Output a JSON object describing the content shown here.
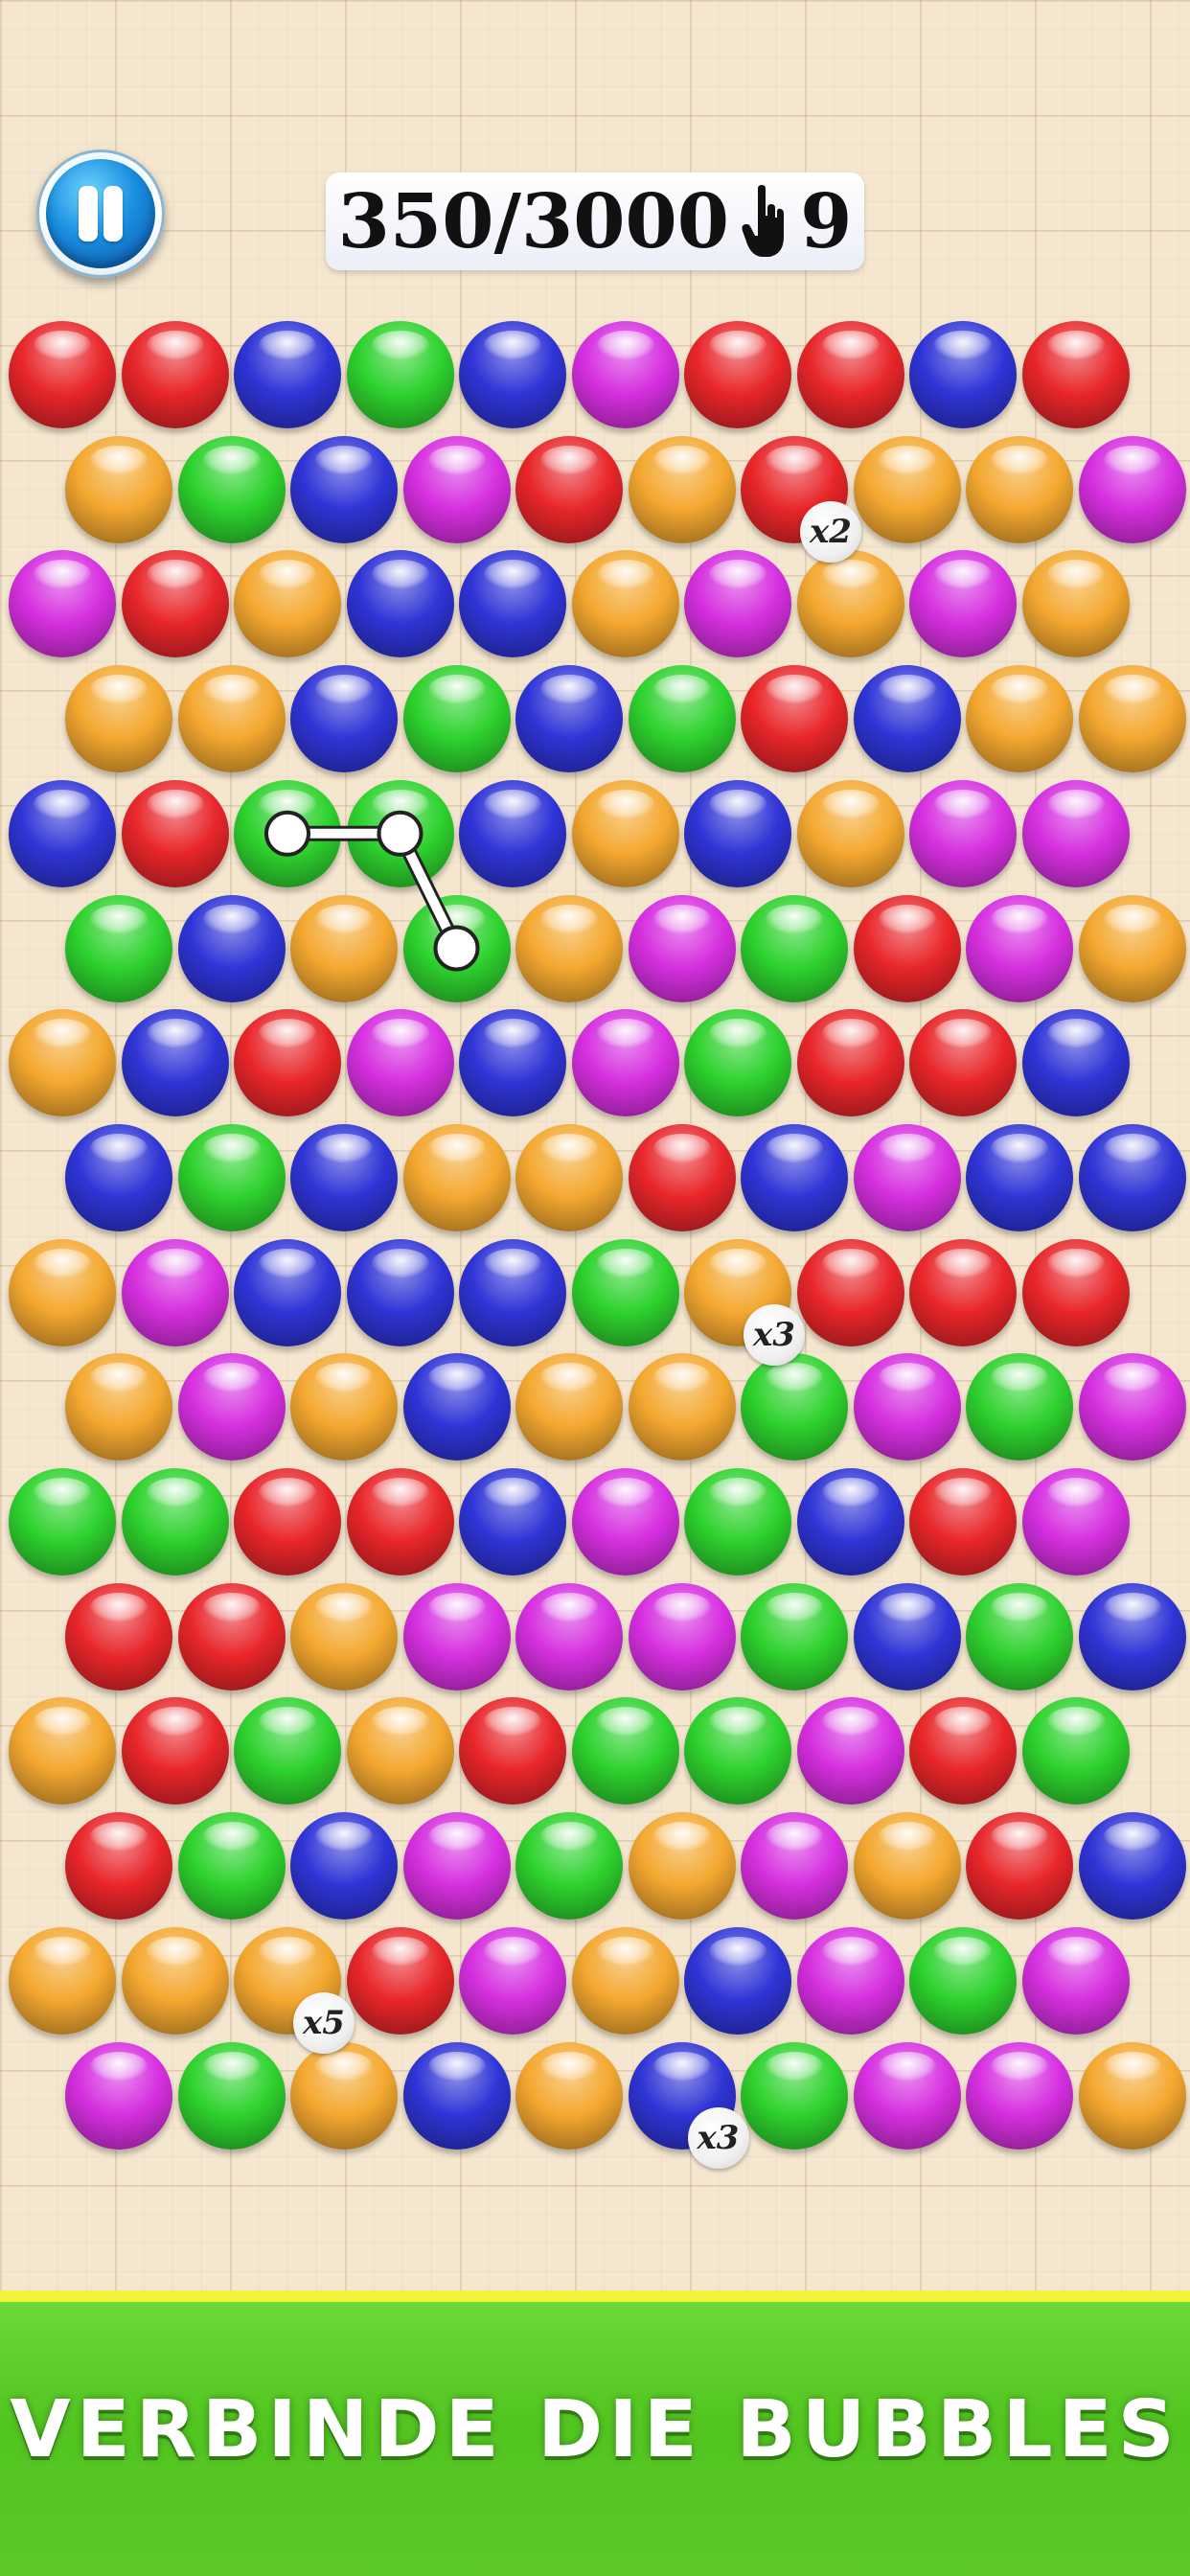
{
  "header": {
    "score": "350/3000",
    "moves": "9",
    "pause_icon": "pause-icon",
    "moves_icon": "hand-pointer-icon"
  },
  "colors": {
    "red": "#e8262a",
    "orange": "#f4a830",
    "green": "#2ed22e",
    "blue": "#2f34d6",
    "magenta": "#d62fe0",
    "footer_green": "#52c520",
    "footer_stripe": "#f2f23a"
  },
  "board": {
    "rows": [
      [
        "red",
        "red",
        "blue",
        "green",
        "blue",
        "magenta",
        "red",
        "red",
        "blue",
        "red"
      ],
      [
        "orange",
        "green",
        "blue",
        "magenta",
        "red",
        "orange",
        "red",
        "orange",
        "orange",
        "magenta"
      ],
      [
        "magenta",
        "red",
        "orange",
        "blue",
        "blue",
        "orange",
        "magenta",
        "orange",
        "magenta",
        "orange"
      ],
      [
        "orange",
        "orange",
        "blue",
        "green",
        "blue",
        "green",
        "red",
        "blue",
        "orange",
        "orange"
      ],
      [
        "blue",
        "red",
        "green",
        "green",
        "blue",
        "orange",
        "blue",
        "orange",
        "magenta",
        "magenta"
      ],
      [
        "green",
        "blue",
        "orange",
        "green",
        "orange",
        "magenta",
        "green",
        "red",
        "magenta",
        "orange"
      ],
      [
        "orange",
        "blue",
        "red",
        "magenta",
        "blue",
        "magenta",
        "green",
        "red",
        "red",
        "blue"
      ],
      [
        "blue",
        "green",
        "blue",
        "orange",
        "orange",
        "red",
        "blue",
        "magenta",
        "blue",
        "blue"
      ],
      [
        "orange",
        "magenta",
        "blue",
        "blue",
        "blue",
        "green",
        "orange",
        "red",
        "red",
        "red"
      ],
      [
        "orange",
        "magenta",
        "orange",
        "blue",
        "orange",
        "orange",
        "green",
        "magenta",
        "green",
        "magenta"
      ],
      [
        "green",
        "green",
        "red",
        "red",
        "blue",
        "magenta",
        "green",
        "blue",
        "red",
        "magenta"
      ],
      [
        "red",
        "red",
        "orange",
        "magenta",
        "magenta",
        "magenta",
        "green",
        "blue",
        "green",
        "blue"
      ],
      [
        "orange",
        "red",
        "green",
        "orange",
        "red",
        "green",
        "green",
        "magenta",
        "red",
        "green"
      ],
      [
        "red",
        "green",
        "blue",
        "magenta",
        "green",
        "orange",
        "magenta",
        "orange",
        "red",
        "blue"
      ],
      [
        "orange",
        "orange",
        "orange",
        "red",
        "magenta",
        "orange",
        "blue",
        "magenta",
        "green",
        "magenta"
      ],
      [
        "magenta",
        "green",
        "orange",
        "blue",
        "orange",
        "blue",
        "green",
        "magenta",
        "magenta",
        "orange"
      ]
    ],
    "multipliers": [
      {
        "row": 1,
        "col": 6,
        "label": "x2"
      },
      {
        "row": 8,
        "col": 6,
        "label": "x3"
      },
      {
        "row": 14,
        "col": 2,
        "label": "x5"
      },
      {
        "row": 15,
        "col": 5,
        "label": "x3"
      }
    ],
    "selected_path": [
      {
        "row": 4,
        "col": 2
      },
      {
        "row": 4,
        "col": 3
      },
      {
        "row": 5,
        "col": 3
      }
    ]
  },
  "footer": {
    "text": "VERBINDE DIE BUBBLES"
  }
}
